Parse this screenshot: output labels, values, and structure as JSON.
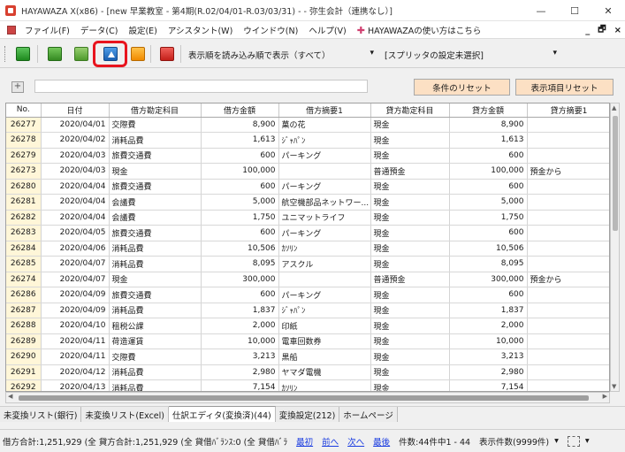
{
  "window": {
    "title": "HAYAWAZA X(x86) - [new 早業教室 - 第4期(R.02/04/01-R.03/03/31) - - 弥生会計（連携なし）]",
    "minimize": "—",
    "maximize": "☐",
    "close": "✕"
  },
  "menu": {
    "items": [
      "ファイル(F)",
      "データ(C)",
      "設定(E)",
      "アシスタント(W)",
      "ウインドウ(N)",
      "ヘルプ(V)"
    ],
    "help_link": "HAYAWAZAの使い方はこちら",
    "mdi_min": "_",
    "mdi_restore": "🗗",
    "mdi_close": "×"
  },
  "toolbar": {
    "sort_combo": "表示順を読み込み順で表示（すべて）",
    "splitter_combo": "[スプリッタの設定未選択]",
    "combo_arrow": "▾"
  },
  "filter": {
    "expand": "+",
    "reset_conditions": "条件のリセット",
    "reset_display": "表示項目リセット"
  },
  "grid": {
    "columns": [
      "No.",
      "日付",
      "借方勘定科目",
      "借方金額",
      "借方摘要1",
      "貸方勘定科目",
      "貸方金額",
      "貸方摘要1"
    ],
    "rows": [
      [
        "26277",
        "2020/04/01",
        "交際費",
        "8,900",
        "菓の花",
        "現金",
        "8,900",
        ""
      ],
      [
        "26278",
        "2020/04/02",
        "消耗品費",
        "1,613",
        "ｼﾞｬﾊﾟﾝ",
        "現金",
        "1,613",
        ""
      ],
      [
        "26279",
        "2020/04/03",
        "旅費交通費",
        "600",
        "パーキング",
        "現金",
        "600",
        ""
      ],
      [
        "26273",
        "2020/04/03",
        "現金",
        "100,000",
        "",
        "普通預金",
        "100,000",
        "預金から"
      ],
      [
        "26280",
        "2020/04/04",
        "旅費交通費",
        "600",
        "パーキング",
        "現金",
        "600",
        ""
      ],
      [
        "26281",
        "2020/04/04",
        "会議費",
        "5,000",
        "航空機部品ネットワー...",
        "現金",
        "5,000",
        ""
      ],
      [
        "26282",
        "2020/04/04",
        "会議費",
        "1,750",
        "ユニマットライフ",
        "現金",
        "1,750",
        ""
      ],
      [
        "26283",
        "2020/04/05",
        "旅費交通費",
        "600",
        "パーキング",
        "現金",
        "600",
        ""
      ],
      [
        "26284",
        "2020/04/06",
        "消耗品費",
        "10,506",
        "ｶｿﾘﾝ",
        "現金",
        "10,506",
        ""
      ],
      [
        "26285",
        "2020/04/07",
        "消耗品費",
        "8,095",
        "アスクル",
        "現金",
        "8,095",
        ""
      ],
      [
        "26274",
        "2020/04/07",
        "現金",
        "300,000",
        "",
        "普通預金",
        "300,000",
        "預金から"
      ],
      [
        "26286",
        "2020/04/09",
        "旅費交通費",
        "600",
        "パーキング",
        "現金",
        "600",
        ""
      ],
      [
        "26287",
        "2020/04/09",
        "消耗品費",
        "1,837",
        "ｼﾞｬﾊﾟﾝ",
        "現金",
        "1,837",
        ""
      ],
      [
        "26288",
        "2020/04/10",
        "租税公課",
        "2,000",
        "印紙",
        "現金",
        "2,000",
        ""
      ],
      [
        "26289",
        "2020/04/11",
        "荷造運賃",
        "10,000",
        "電車回数券",
        "現金",
        "10,000",
        ""
      ],
      [
        "26290",
        "2020/04/11",
        "交際費",
        "3,213",
        "黒船",
        "現金",
        "3,213",
        ""
      ],
      [
        "26291",
        "2020/04/12",
        "消耗品費",
        "2,980",
        "ヤマダ電機",
        "現金",
        "2,980",
        ""
      ],
      [
        "26292",
        "2020/04/13",
        "消耗品費",
        "7,154",
        "ｶｿﾘﾝ",
        "現金",
        "7,154",
        ""
      ]
    ]
  },
  "tabs": [
    "未変換リスト(銀行)",
    "未変換リスト(Excel)",
    "仕訳エディタ(変換済)(44)",
    "変換設定(212)",
    "ホームページ"
  ],
  "active_tab": 2,
  "status": {
    "totals": "借方合計:1,251,929 (全 貸方合計:1,251,929 (全 貸借ﾊﾞﾗﾝｽ:0 (全 貸借ﾊﾞﾗ",
    "first": "最初",
    "prev": "前へ",
    "next": "次へ",
    "last": "最後",
    "count": "件数:44件中1 - 44",
    "display_count": "表示件数(9999件)",
    "dd_arrow": "▾"
  }
}
